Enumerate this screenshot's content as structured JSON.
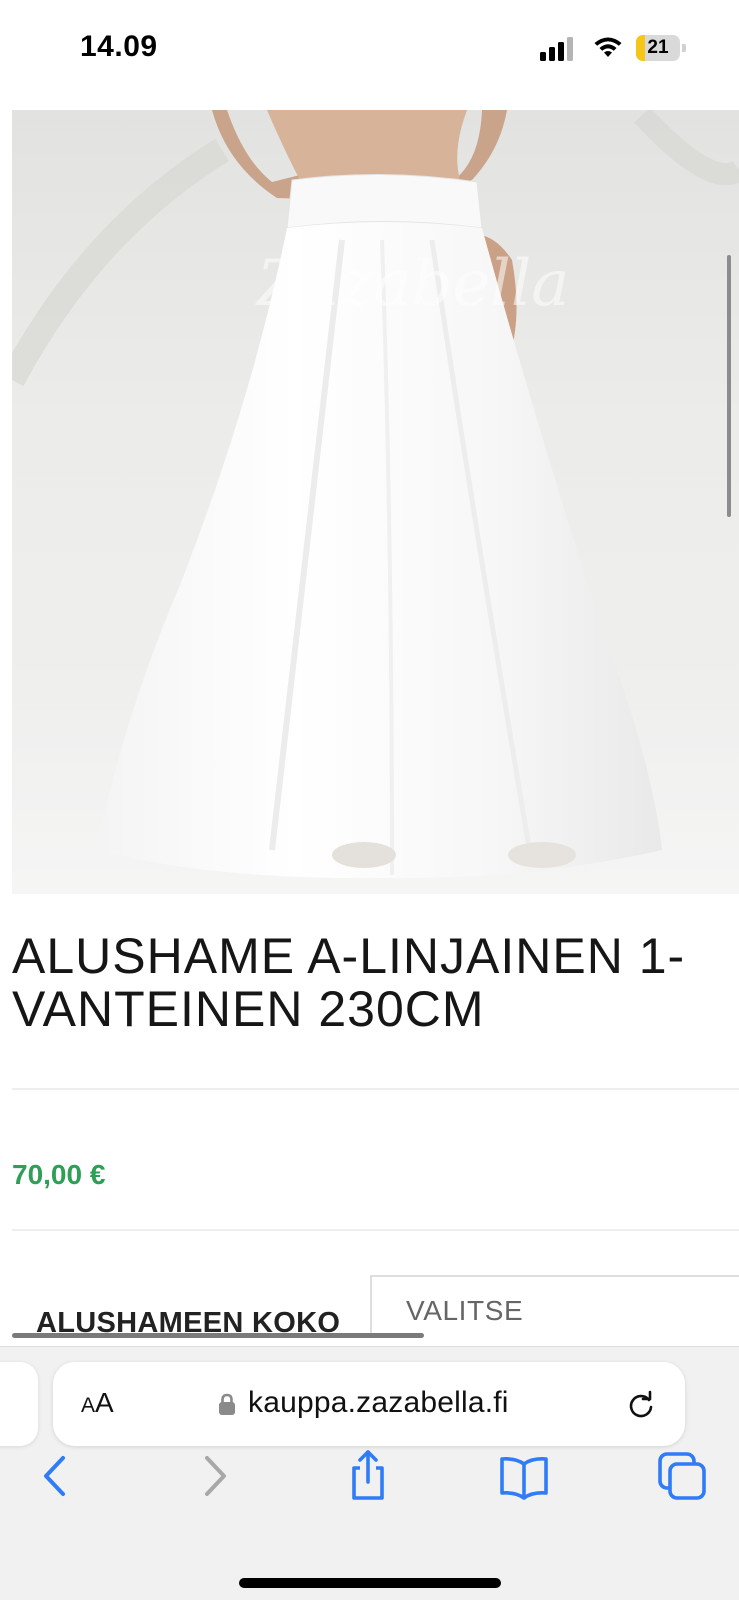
{
  "status_bar": {
    "time": "14.09",
    "battery_level": "21",
    "battery_fraction": 0.21,
    "icons": [
      "cellular-signal-icon",
      "wifi-icon",
      "battery-icon"
    ]
  },
  "product": {
    "image_watermark": "Zazabella",
    "title_line_1": "ALUSHAME A-LINJAINEN 1-",
    "title_line_2": "VANTEINEN 230CM",
    "price": "70,00 €",
    "price_color": "#2f9e56"
  },
  "options": {
    "label": "ALUSHAMEEN KOKO",
    "select_value": "VALITSE"
  },
  "browser": {
    "text_size_button": "AA",
    "url": "kauppa.zazabella.fi",
    "icons": [
      "lock-icon",
      "reload-icon",
      "back-icon",
      "forward-icon",
      "share-icon",
      "bookmarks-icon",
      "tabs-icon"
    ],
    "accent_color": "#2f7cf6",
    "disabled_color": "#a8a8a8"
  }
}
